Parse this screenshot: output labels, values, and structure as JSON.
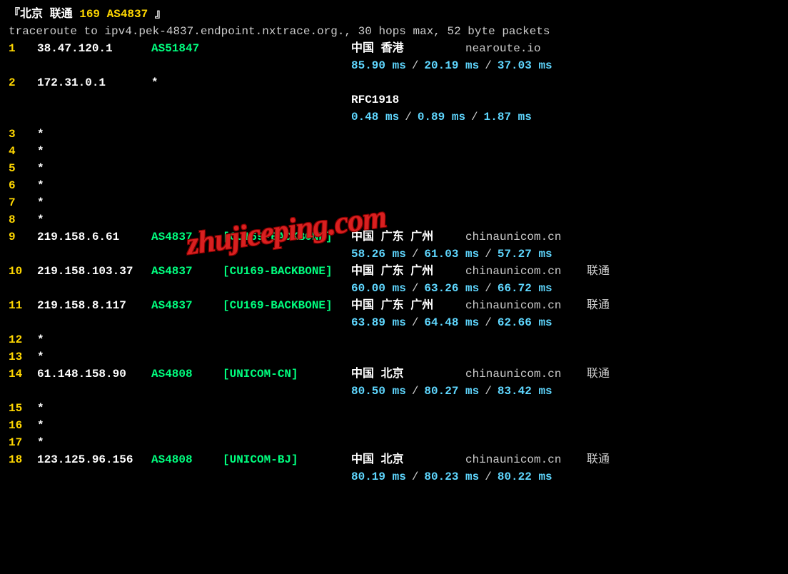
{
  "header": {
    "prefix": "『北京 联通 ",
    "as": "169 AS4837",
    "suffix": " 』"
  },
  "cmd": "traceroute to ipv4.pek-4837.endpoint.nxtrace.org., 30 hops max, 52 byte packets",
  "hops": [
    {
      "n": "1",
      "ip": "38.47.120.1",
      "as": "AS51847",
      "net": "",
      "loc": "中国 香港",
      "host": "nearoute.io",
      "carrier": "",
      "rtt": [
        "85.90 ms",
        "20.19 ms",
        "37.03 ms"
      ]
    },
    {
      "n": "2",
      "ip": "172.31.0.1",
      "as": "*",
      "net": "",
      "loc": "RFC1918",
      "host": "",
      "carrier": "",
      "rtt": [
        "0.48 ms",
        "0.89 ms",
        "1.87 ms"
      ],
      "rfc": true
    },
    {
      "n": "3",
      "ip": "*"
    },
    {
      "n": "4",
      "ip": "*"
    },
    {
      "n": "5",
      "ip": "*"
    },
    {
      "n": "6",
      "ip": "*"
    },
    {
      "n": "7",
      "ip": "*"
    },
    {
      "n": "8",
      "ip": "*"
    },
    {
      "n": "9",
      "ip": "219.158.6.61",
      "as": "AS4837",
      "net": "[CU169-BACKBONE]",
      "loc": "中国 广东 广州",
      "host": "chinaunicom.cn",
      "carrier": "",
      "rtt": [
        "58.26 ms",
        "61.03 ms",
        "57.27 ms"
      ]
    },
    {
      "n": "10",
      "ip": "219.158.103.37",
      "as": "AS4837",
      "net": "[CU169-BACKBONE]",
      "loc": "中国 广东 广州",
      "host": "chinaunicom.cn",
      "carrier": "联通",
      "rtt": [
        "60.00 ms",
        "63.26 ms",
        "66.72 ms"
      ]
    },
    {
      "n": "11",
      "ip": "219.158.8.117",
      "as": "AS4837",
      "net": "[CU169-BACKBONE]",
      "loc": "中国 广东 广州",
      "host": "chinaunicom.cn",
      "carrier": "联通",
      "rtt": [
        "63.89 ms",
        "64.48 ms",
        "62.66 ms"
      ]
    },
    {
      "n": "12",
      "ip": "*"
    },
    {
      "n": "13",
      "ip": "*"
    },
    {
      "n": "14",
      "ip": "61.148.158.90",
      "as": "AS4808",
      "net": "[UNICOM-CN]",
      "loc": "中国 北京",
      "host": "chinaunicom.cn",
      "carrier": "联通",
      "rtt": [
        "80.50 ms",
        "80.27 ms",
        "83.42 ms"
      ]
    },
    {
      "n": "15",
      "ip": "*"
    },
    {
      "n": "16",
      "ip": "*"
    },
    {
      "n": "17",
      "ip": "*"
    },
    {
      "n": "18",
      "ip": "123.125.96.156",
      "as": "AS4808",
      "net": "[UNICOM-BJ]",
      "loc": "中国 北京",
      "host": "chinaunicom.cn",
      "carrier": "联通",
      "rtt": [
        "80.19 ms",
        "80.23 ms",
        "80.22 ms"
      ]
    }
  ],
  "sep": "/",
  "watermark": "zhujiceping.com"
}
